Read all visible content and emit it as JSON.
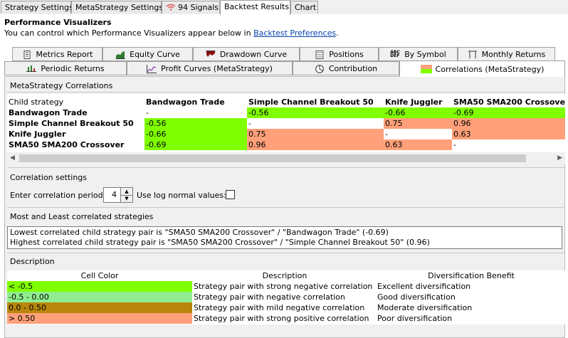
{
  "top_tabs": [
    {
      "label": "Strategy Settings"
    },
    {
      "label": "MetaStrategy Settings"
    },
    {
      "label": "94 Signals",
      "icon": "wifi-signal-icon"
    },
    {
      "label": "Backtest Results",
      "active": true
    },
    {
      "label": "Chart"
    }
  ],
  "header": {
    "title": "Performance Visualizers",
    "subtitle_prefix": "You can control which Performance Visualizers appear below in ",
    "link": "Backtest Preferences",
    "subtitle_suffix": "."
  },
  "viz_tabs_row1": [
    {
      "label": "Metrics Report",
      "icon": "document-icon"
    },
    {
      "label": "Equity Curve",
      "icon": "equity-chart-icon"
    },
    {
      "label": "Drawdown Curve",
      "icon": "drawdown-chart-icon"
    },
    {
      "label": "Positions",
      "icon": "list-icon"
    },
    {
      "label": "By Symbol",
      "icon": "symbol-abc-icon"
    },
    {
      "label": "Monthly Returns",
      "icon": "calendar-columns-icon"
    }
  ],
  "viz_tabs_row2": [
    {
      "label": "Periodic Returns",
      "icon": "bar-chart-icon"
    },
    {
      "label": "Profit Curves (MetaStrategy)",
      "icon": "line-chart-icon"
    },
    {
      "label": "Contribution",
      "icon": "pie-chart-icon"
    },
    {
      "label": "Correlations (MetaStrategy)",
      "icon": "color-swatch-icon",
      "active": true
    }
  ],
  "correlations": {
    "section_title": "MetaStrategy Correlations",
    "corner_label": "Child strategy",
    "columns": [
      "Bandwagon Trade",
      "Simple Channel Breakout 50",
      "Knife Juggler",
      "SMA50 SMA200 Crossover"
    ],
    "rows": [
      {
        "label": "Bandwagon Trade",
        "cells": [
          {
            "v": "-",
            "c": "white"
          },
          {
            "v": "-0.56",
            "c": "strong_neg"
          },
          {
            "v": "-0.66",
            "c": "strong_neg"
          },
          {
            "v": "-0.69",
            "c": "strong_neg"
          }
        ]
      },
      {
        "label": "Simple Channel Breakout 50",
        "cells": [
          {
            "v": "-0.56",
            "c": "strong_neg"
          },
          {
            "v": "-",
            "c": "white"
          },
          {
            "v": "0.75",
            "c": "strong_pos"
          },
          {
            "v": "0.96",
            "c": "strong_pos"
          }
        ]
      },
      {
        "label": "Knife Juggler",
        "cells": [
          {
            "v": "-0.66",
            "c": "strong_neg"
          },
          {
            "v": "0.75",
            "c": "strong_pos"
          },
          {
            "v": "-",
            "c": "white"
          },
          {
            "v": "0.63",
            "c": "strong_pos"
          }
        ]
      },
      {
        "label": "SMA50 SMA200 Crossover",
        "cells": [
          {
            "v": "-0.69",
            "c": "strong_neg"
          },
          {
            "v": "0.96",
            "c": "strong_pos"
          },
          {
            "v": "0.63",
            "c": "strong_pos"
          },
          {
            "v": "-",
            "c": "white"
          }
        ]
      }
    ]
  },
  "settings": {
    "section_title": "Correlation settings",
    "period_label": "Enter correlation period:",
    "period_value": "4",
    "log_label": "Use log normal values:",
    "log_checked": false
  },
  "most_least": {
    "section_title": "Most and Least correlated strategies",
    "lines": [
      "Lowest correlated child strategy pair is \"SMA50 SMA200 Crossover\" / \"Bandwagon Trade\" (-0.69)",
      "Highest correlated child strategy pair is \"SMA50 SMA200 Crossover\" / \"Simple Channel Breakout 50\" (0.96)"
    ]
  },
  "description": {
    "section_title": "Description",
    "headers": [
      "Cell Color",
      "Description",
      "Diversification Benefit"
    ],
    "rows": [
      {
        "range": "< -0.5",
        "color": "strong_neg",
        "desc": "Strategy pair with strong negative correlation",
        "benefit": "Excellent diversification"
      },
      {
        "range": "-0.5 - 0.00",
        "color": "neg",
        "desc": "Strategy pair with negative correlation",
        "benefit": "Good diversification"
      },
      {
        "range": "0.0 - 0.50",
        "color": "mild",
        "desc": "Strategy pair with mild negative correlation",
        "benefit": "Moderate diversification"
      },
      {
        "range": "> 0.50",
        "color": "strong_pos",
        "desc": "Strategy pair with strong positive correlation",
        "benefit": "Poor diversification"
      }
    ]
  },
  "colors": {
    "strong_neg": "#80ff00",
    "neg": "#90ee90",
    "mild": "#b8860b",
    "strong_pos": "#ffa07a",
    "white": "#ffffff",
    "link": "#0645ad"
  }
}
